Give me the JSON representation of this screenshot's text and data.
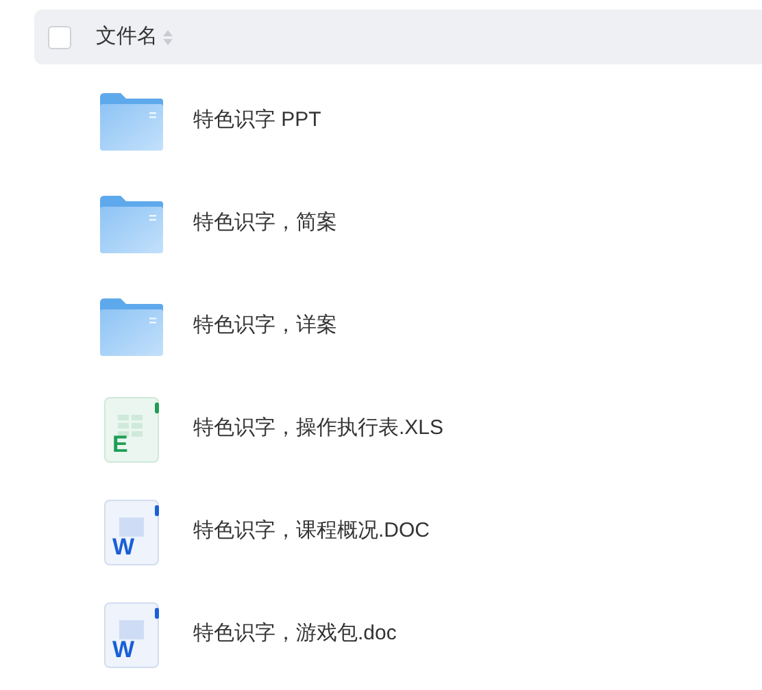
{
  "header": {
    "checked": false,
    "column": "文件名"
  },
  "files": [
    {
      "kind": "folder",
      "name": "特色识字 PPT"
    },
    {
      "kind": "folder",
      "name": "特色识字，简案"
    },
    {
      "kind": "folder",
      "name": "特色识字，详案"
    },
    {
      "kind": "sheet",
      "icon_letter": "E",
      "name": "特色识字，操作执行表.XLS"
    },
    {
      "kind": "doc",
      "icon_letter": "W",
      "name": "特色识字，课程概况.DOC"
    },
    {
      "kind": "doc",
      "icon_letter": "W",
      "name": "特色识字，游戏包.doc"
    }
  ]
}
